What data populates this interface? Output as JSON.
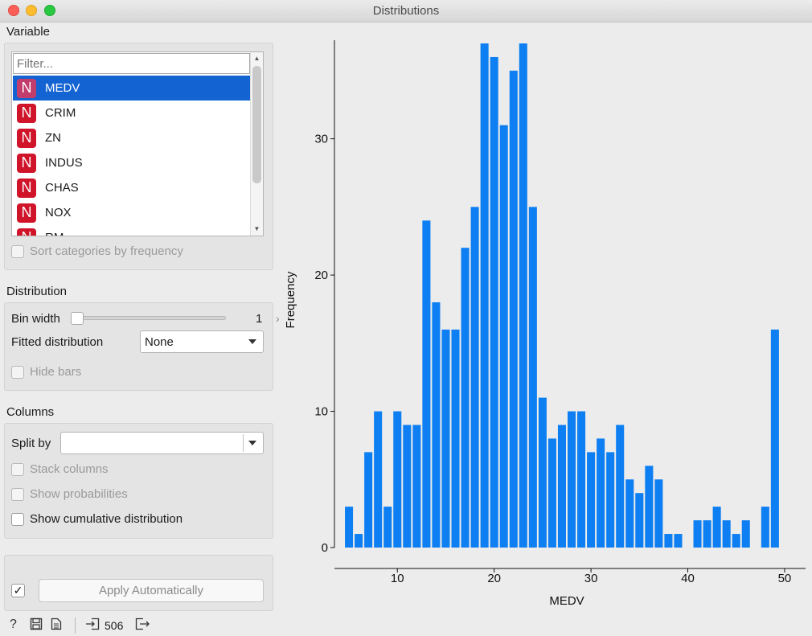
{
  "window": {
    "title": "Distributions"
  },
  "variable": {
    "section_label": "Variable",
    "filter_placeholder": "Filter...",
    "icon_letter": "N",
    "items": [
      {
        "label": "MEDV",
        "selected": true
      },
      {
        "label": "CRIM"
      },
      {
        "label": "ZN"
      },
      {
        "label": "INDUS"
      },
      {
        "label": "CHAS"
      },
      {
        "label": "NOX"
      },
      {
        "label": "RM"
      }
    ],
    "sort_by_frequency_label": "Sort categories by frequency"
  },
  "distribution": {
    "section_label": "Distribution",
    "bin_width_label": "Bin width",
    "bin_width_value": "1",
    "fitted_label": "Fitted distribution",
    "fitted_value": "None",
    "hide_bars_label": "Hide bars"
  },
  "columns": {
    "section_label": "Columns",
    "split_by_label": "Split by",
    "split_by_value": "",
    "stack_columns_label": "Stack columns",
    "show_probabilities_label": "Show probabilities",
    "show_cumulative_label": "Show cumulative distribution"
  },
  "apply": {
    "label": "Apply Automatically",
    "checked": true,
    "check_glyph": "✓"
  },
  "status": {
    "count": "506"
  },
  "chart_data": {
    "type": "bar",
    "xlabel": "MEDV",
    "ylabel": "Frequency",
    "xlim": [
      3.5,
      52
    ],
    "ylim": [
      0,
      37
    ],
    "xticks": [
      10,
      20,
      30,
      40,
      50
    ],
    "yticks": [
      0,
      10,
      20,
      30
    ],
    "bar_color": "#0d7ff2",
    "bins": [
      {
        "x": 5,
        "y": 3
      },
      {
        "x": 6,
        "y": 1
      },
      {
        "x": 7,
        "y": 7
      },
      {
        "x": 8,
        "y": 10
      },
      {
        "x": 9,
        "y": 3
      },
      {
        "x": 10,
        "y": 10
      },
      {
        "x": 11,
        "y": 9
      },
      {
        "x": 12,
        "y": 9
      },
      {
        "x": 13,
        "y": 24
      },
      {
        "x": 14,
        "y": 18
      },
      {
        "x": 15,
        "y": 16
      },
      {
        "x": 16,
        "y": 16
      },
      {
        "x": 17,
        "y": 22
      },
      {
        "x": 18,
        "y": 25
      },
      {
        "x": 19,
        "y": 37
      },
      {
        "x": 20,
        "y": 36
      },
      {
        "x": 21,
        "y": 31
      },
      {
        "x": 22,
        "y": 35
      },
      {
        "x": 23,
        "y": 37
      },
      {
        "x": 24,
        "y": 25
      },
      {
        "x": 25,
        "y": 11
      },
      {
        "x": 26,
        "y": 8
      },
      {
        "x": 27,
        "y": 9
      },
      {
        "x": 28,
        "y": 10
      },
      {
        "x": 29,
        "y": 10
      },
      {
        "x": 30,
        "y": 7
      },
      {
        "x": 31,
        "y": 8
      },
      {
        "x": 32,
        "y": 7
      },
      {
        "x": 33,
        "y": 9
      },
      {
        "x": 34,
        "y": 5
      },
      {
        "x": 35,
        "y": 4
      },
      {
        "x": 36,
        "y": 6
      },
      {
        "x": 37,
        "y": 5
      },
      {
        "x": 38,
        "y": 1
      },
      {
        "x": 39,
        "y": 1
      },
      {
        "x": 41,
        "y": 2
      },
      {
        "x": 42,
        "y": 2
      },
      {
        "x": 43,
        "y": 3
      },
      {
        "x": 44,
        "y": 2
      },
      {
        "x": 45,
        "y": 1
      },
      {
        "x": 46,
        "y": 2
      },
      {
        "x": 48,
        "y": 3
      },
      {
        "x": 49,
        "y": 16
      }
    ]
  }
}
